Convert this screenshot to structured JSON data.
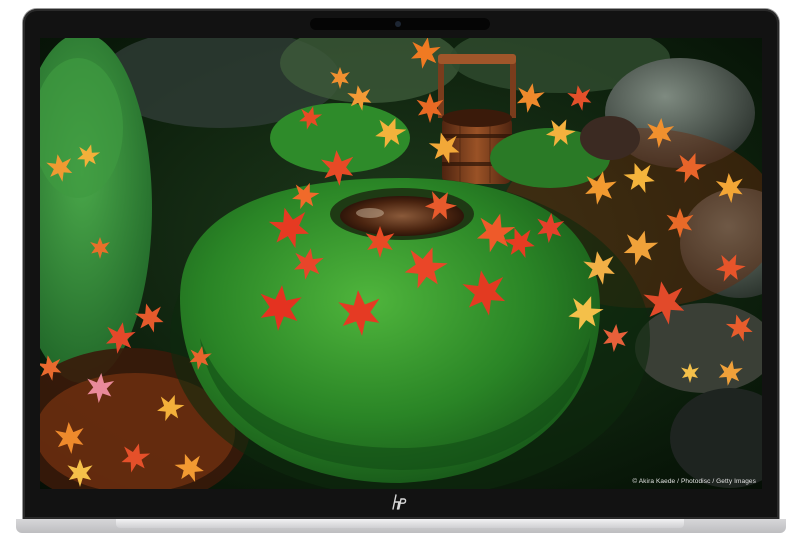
{
  "device": {
    "brand_logo_icon": "hp-logo-icon"
  },
  "wallpaper": {
    "subject": "moss-covered stone basin with red maple leaves and wooden bucket",
    "credit": "© Akira Kaede / Photodisc / Getty Images"
  },
  "colors": {
    "bezel": "#121212",
    "chassis": "#c9c9cc",
    "moss": "#2f8a2a",
    "leaf_red": "#e33a1f",
    "leaf_orange": "#f07a22",
    "leaf_yellow": "#f2b43a",
    "water": "#5a2e14",
    "wood": "#7a3c1c"
  }
}
